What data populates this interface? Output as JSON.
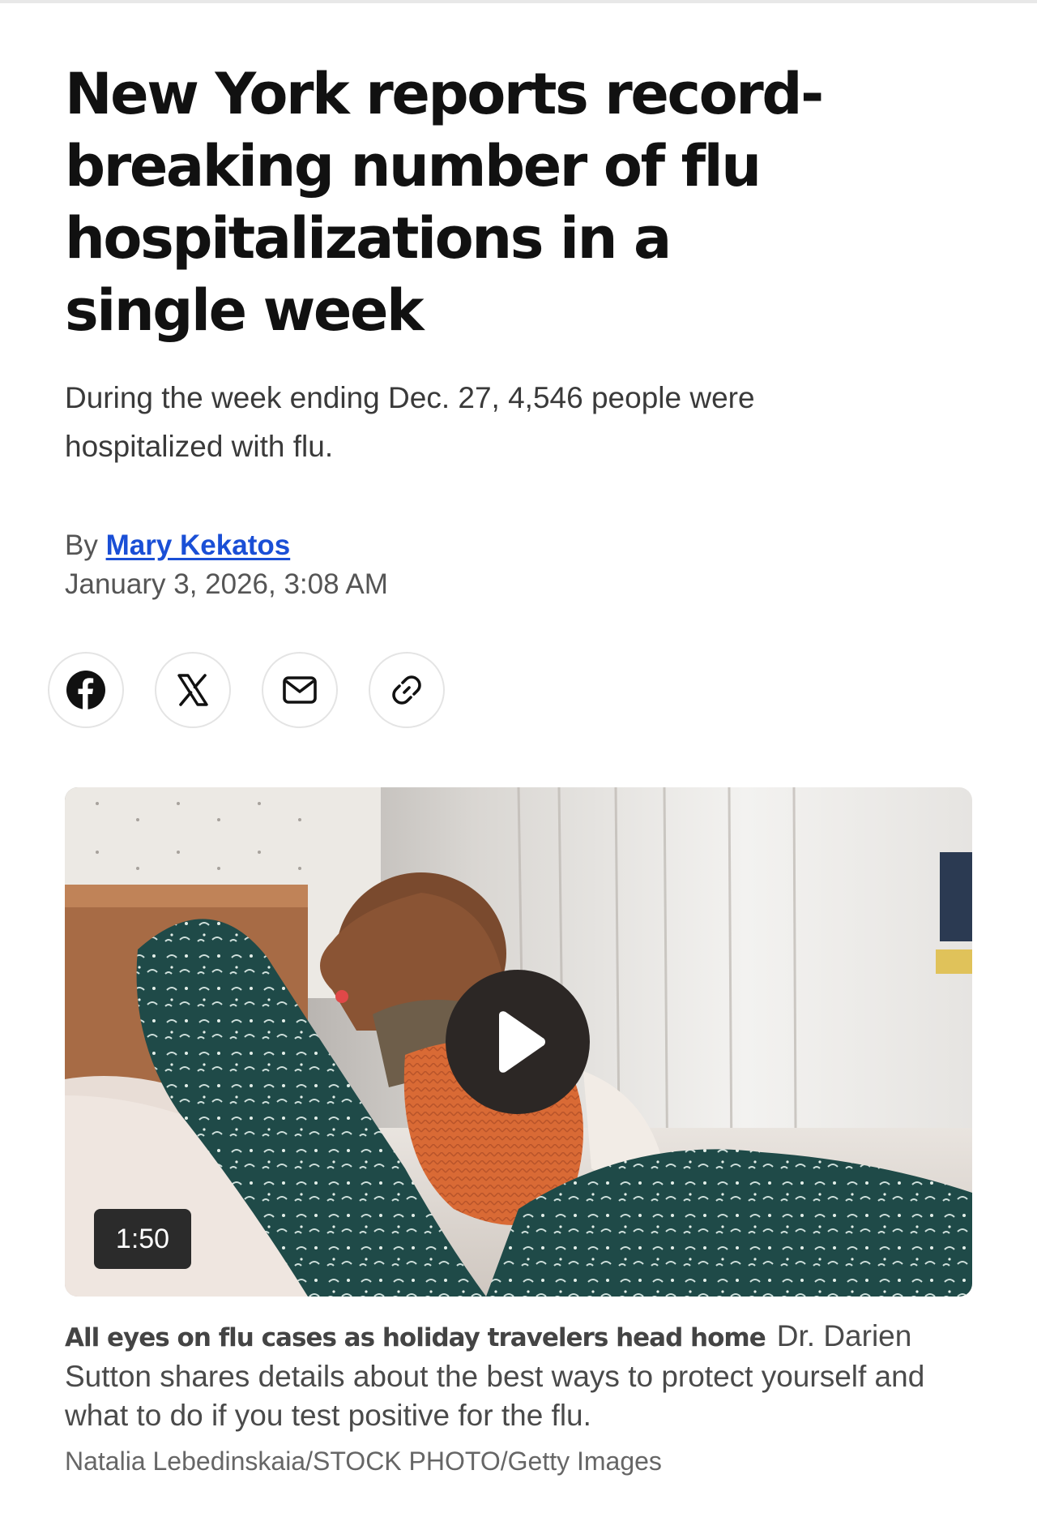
{
  "article": {
    "headline": "New York reports record-breaking number of flu hospitalizations in a single week",
    "dek": "During the week ending Dec. 27, 4,546 people were hospitalized with flu.",
    "byline_prefix": "By",
    "author": "Mary Kekatos",
    "timestamp": "January 3, 2026, 3:08 AM"
  },
  "share": {
    "buttons": [
      {
        "icon": "facebook-icon"
      },
      {
        "icon": "x-icon"
      },
      {
        "icon": "mail-icon"
      },
      {
        "icon": "link-icon"
      }
    ]
  },
  "video": {
    "duration": "1:50",
    "icon": "play-icon",
    "caption_title": "All eyes on flu cases as holiday travelers head home",
    "caption_text": "Dr. Darien Sutton shares details about the best ways to protect yourself and what to do if you test positive for the flu.",
    "credit": "Natalia Lebedinskaia/STOCK PHOTO/Getty Images"
  },
  "colors": {
    "link": "#1a4fd6",
    "headline": "#111111",
    "duration_badge": "#2b2b2b",
    "play_button": "#2c2725"
  }
}
